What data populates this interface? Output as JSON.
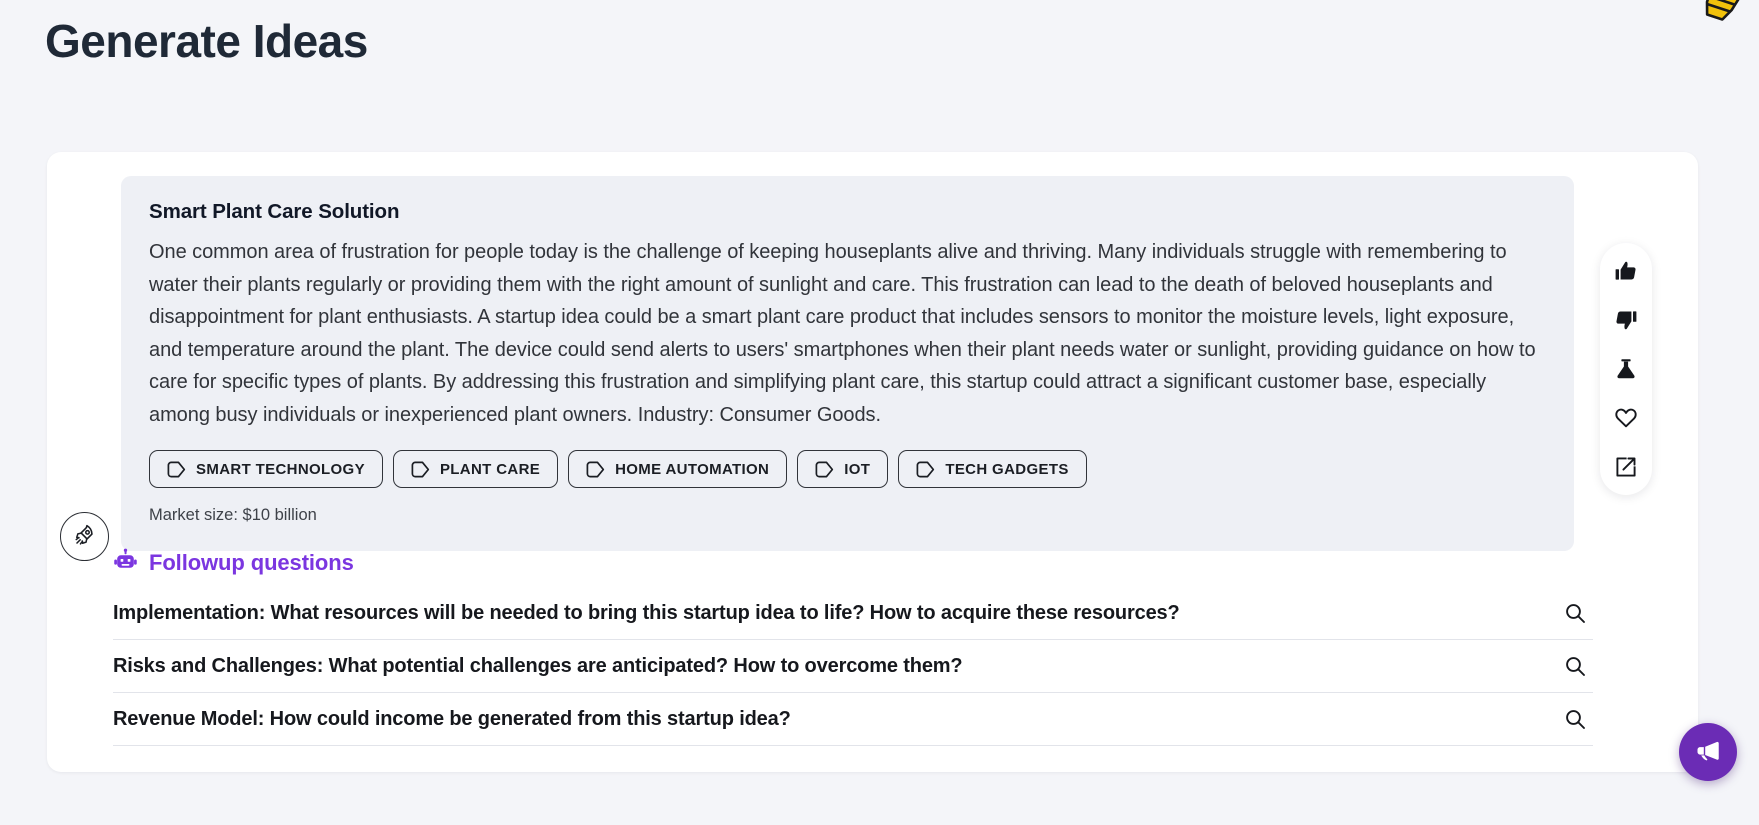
{
  "page": {
    "title": "Generate Ideas",
    "background_color": "#f4f5f9",
    "accent_color": "#7b36e0"
  },
  "idea": {
    "title": "Smart Plant Care Solution",
    "body": "One common area of frustration for people today is the challenge of keeping houseplants alive and thriving. Many individuals struggle with remembering to water their plants regularly or providing them with the right amount of sunlight and care. This frustration can lead to the death of beloved houseplants and disappointment for plant enthusiasts. A startup idea could be a smart plant care product that includes sensors to monitor the moisture levels, light exposure, and temperature around the plant. The device could send alerts to users' smartphones when their plant needs water or sunlight, providing guidance on how to care for specific types of plants. By addressing this frustration and simplifying plant care, this startup could attract a significant customer base, especially among busy individuals or inexperienced plant owners. Industry: Consumer Goods.",
    "tags": [
      {
        "label": "SMART TECHNOLOGY",
        "icon": "tag-icon"
      },
      {
        "label": "PLANT CARE",
        "icon": "tag-icon"
      },
      {
        "label": "HOME AUTOMATION",
        "icon": "tag-icon"
      },
      {
        "label": "IOT",
        "icon": "tag-icon"
      },
      {
        "label": "TECH GADGETS",
        "icon": "tag-icon"
      }
    ],
    "market_size": "Market size: $10 billion"
  },
  "followup": {
    "heading": "Followup questions",
    "heading_icon": "robot-icon",
    "questions": [
      {
        "text": "Implementation: What resources will be needed to bring this startup idea to life? How to acquire these resources?",
        "action_icon": "search-icon"
      },
      {
        "text": "Risks and Challenges: What potential challenges are anticipated? How to overcome them?",
        "action_icon": "search-icon"
      },
      {
        "text": "Revenue Model: How could income be generated from this startup idea?",
        "action_icon": "search-icon"
      }
    ]
  },
  "action_rail": {
    "buttons": [
      {
        "name": "thumbs-up-icon",
        "label": "Like"
      },
      {
        "name": "thumbs-down-icon",
        "label": "Dislike"
      },
      {
        "name": "flask-icon",
        "label": "Experiment"
      },
      {
        "name": "heart-icon",
        "label": "Favorite"
      },
      {
        "name": "external-link-icon",
        "label": "Open"
      }
    ]
  },
  "left_control": {
    "icon": "rocket-icon",
    "label": "Generate"
  },
  "fab": {
    "icon": "megaphone-icon",
    "label": "Feedback",
    "color": "#6b2cb5"
  },
  "decor": {
    "cursor_icon": "pointing-hand-cursor",
    "cursor_color": "#f2c20b"
  }
}
